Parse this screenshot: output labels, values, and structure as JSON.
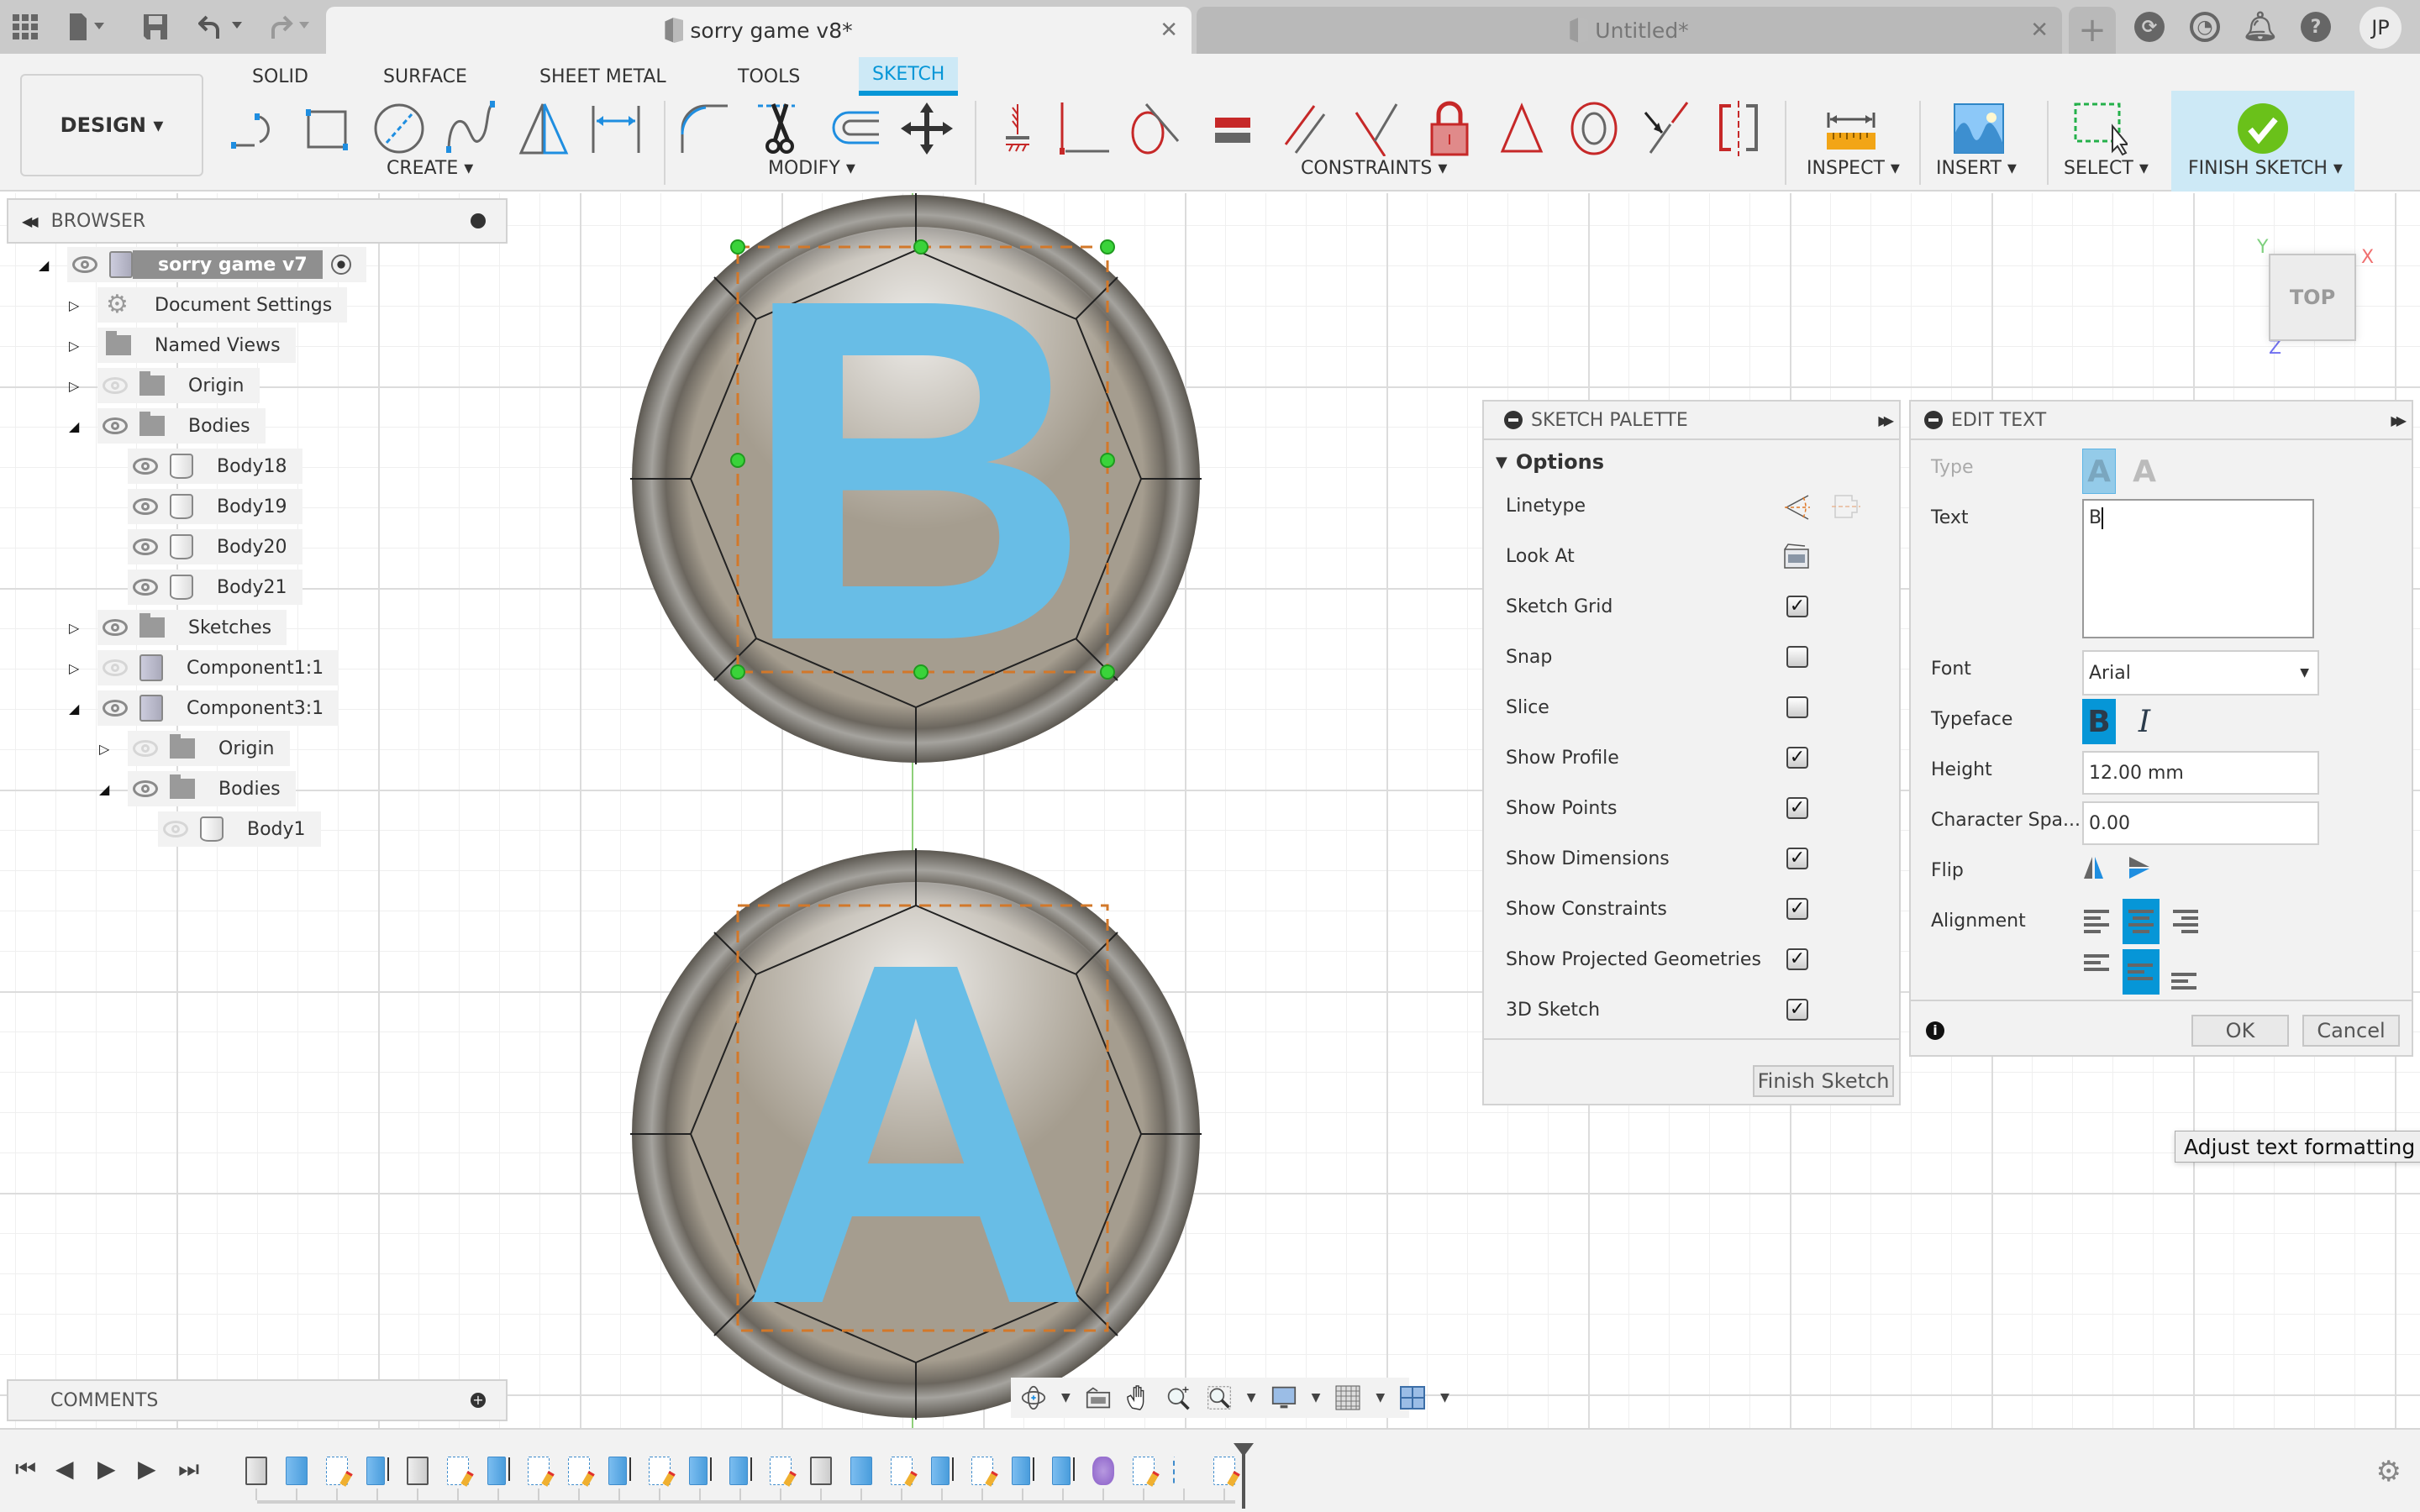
{
  "app": {
    "active_tab": "sorry game v8*",
    "inactive_tab": "Untitled*",
    "close_glyph": "✕",
    "new_tab_glyph": "+",
    "user_initials": "JP",
    "quick_access_icons": [
      "apps-grid-icon",
      "file-icon",
      "save-icon",
      "undo-icon",
      "redo-icon"
    ],
    "top_right_icons": [
      "extensions-icon",
      "job-status-icon",
      "notifications-icon",
      "help-icon"
    ]
  },
  "ribbon": {
    "workspace": "DESIGN ▾",
    "tabs": [
      "SOLID",
      "SURFACE",
      "SHEET METAL",
      "TOOLS",
      "SKETCH"
    ],
    "active_tab": "SKETCH",
    "groups": {
      "create": {
        "label": "CREATE ▾",
        "tools": [
          "line",
          "rectangle",
          "circle",
          "spline",
          "triangle-mirror",
          "sketch-dimension"
        ]
      },
      "modify": {
        "label": "MODIFY ▾",
        "tools": [
          "fillet",
          "trim",
          "offset",
          "move-copy"
        ]
      },
      "constraints": {
        "label": "CONSTRAINTS ▾",
        "tools": [
          "horizontal-vertical",
          "coincident",
          "tangent",
          "equal",
          "parallel",
          "perpendicular",
          "fix-unfix",
          "midpoint",
          "concentric",
          "collinear",
          "symmetry"
        ]
      },
      "inspect": {
        "label": "INSPECT ▾"
      },
      "insert": {
        "label": "INSERT ▾"
      },
      "select": {
        "label": "SELECT ▾"
      },
      "finish": {
        "label": "FINISH SKETCH ▾"
      }
    }
  },
  "browser": {
    "title": "BROWSER",
    "items": [
      {
        "label": "sorry game v7",
        "depth": 0,
        "expanded": true,
        "visible": true,
        "icon": "component-icon",
        "root": true
      },
      {
        "label": "Document Settings",
        "depth": 1,
        "expanded": false,
        "icon": "gear-icon"
      },
      {
        "label": "Named Views",
        "depth": 1,
        "expanded": false,
        "icon": "folder-icon"
      },
      {
        "label": "Origin",
        "depth": 1,
        "expanded": false,
        "visible": false,
        "icon": "folder-icon"
      },
      {
        "label": "Bodies",
        "depth": 1,
        "expanded": true,
        "visible": true,
        "icon": "folder-icon"
      },
      {
        "label": "Body18",
        "depth": 2,
        "visible": true,
        "icon": "body-icon"
      },
      {
        "label": "Body19",
        "depth": 2,
        "visible": true,
        "icon": "body-icon"
      },
      {
        "label": "Body20",
        "depth": 2,
        "visible": true,
        "icon": "body-icon"
      },
      {
        "label": "Body21",
        "depth": 2,
        "visible": true,
        "icon": "body-icon"
      },
      {
        "label": "Sketches",
        "depth": 1,
        "expanded": false,
        "visible": true,
        "icon": "folder-icon"
      },
      {
        "label": "Component1:1",
        "depth": 1,
        "expanded": false,
        "visible": false,
        "icon": "component-icon"
      },
      {
        "label": "Component3:1",
        "depth": 1,
        "expanded": true,
        "visible": true,
        "icon": "component-single-icon"
      },
      {
        "label": "Origin",
        "depth": 2,
        "expanded": false,
        "visible": false,
        "icon": "folder-icon"
      },
      {
        "label": "Bodies",
        "depth": 2,
        "expanded": true,
        "visible": true,
        "icon": "folder-icon"
      },
      {
        "label": "Body1",
        "depth": 3,
        "visible": false,
        "icon": "body-icon"
      }
    ]
  },
  "comments": {
    "title": "COMMENTS"
  },
  "canvas": {
    "tokens": [
      {
        "letter": "B",
        "color": "#68bde6"
      },
      {
        "letter": "A",
        "color": "#68bde6"
      }
    ],
    "viewcube_face": "TOP",
    "axes": {
      "x": "X",
      "y": "Y",
      "z": "Z"
    }
  },
  "sketch_palette": {
    "title": "SKETCH PALETTE",
    "section": "Options",
    "rows": [
      {
        "label": "Linetype",
        "kind": "icons"
      },
      {
        "label": "Look At",
        "kind": "icon"
      },
      {
        "label": "Sketch Grid",
        "checked": true
      },
      {
        "label": "Snap",
        "checked": false
      },
      {
        "label": "Slice",
        "checked": false
      },
      {
        "label": "Show Profile",
        "checked": true
      },
      {
        "label": "Show Points",
        "checked": true
      },
      {
        "label": "Show Dimensions",
        "checked": true
      },
      {
        "label": "Show Constraints",
        "checked": true
      },
      {
        "label": "Show Projected Geometries",
        "checked": true
      },
      {
        "label": "3D Sketch",
        "checked": true
      }
    ],
    "finish_button": "Finish Sketch",
    "check_glyph": "✓"
  },
  "edit_text": {
    "title": "EDIT TEXT",
    "type_label": "Type",
    "text_label": "Text",
    "text_value": "B",
    "font_label": "Font",
    "font_value": "Arial",
    "typeface_label": "Typeface",
    "bold_glyph": "B",
    "italic_glyph": "I",
    "bold_selected": true,
    "height_label": "Height",
    "height_value": "12.00 mm",
    "spacing_label": "Character Spa...",
    "spacing_value": "0.00",
    "flip_label": "Flip",
    "alignment_label": "Alignment",
    "horizontal_alignment": "center",
    "vertical_alignment": "middle",
    "ok_label": "OK",
    "cancel_label": "Cancel",
    "type_glyph": "A"
  },
  "tooltip": "Adjust text formatting o",
  "navbar": {
    "tools": [
      "orbit",
      "look-at",
      "pan",
      "zoom",
      "fit",
      "display-settings",
      "grid-snaps",
      "viewports"
    ]
  },
  "timeline": {
    "controls": [
      "first",
      "previous",
      "play",
      "next",
      "last"
    ],
    "items": [
      "body-white",
      "body-blue",
      "sketch",
      "extrude",
      "body-white",
      "sketch",
      "extrude",
      "sketch",
      "sketch",
      "extrude",
      "sketch",
      "extrude",
      "extrude",
      "sketch",
      "body-white",
      "body-blue",
      "sketch",
      "extrude",
      "sketch",
      "extrude",
      "extrude",
      "feature-purple",
      "sketch",
      "joint",
      "sketch"
    ]
  }
}
